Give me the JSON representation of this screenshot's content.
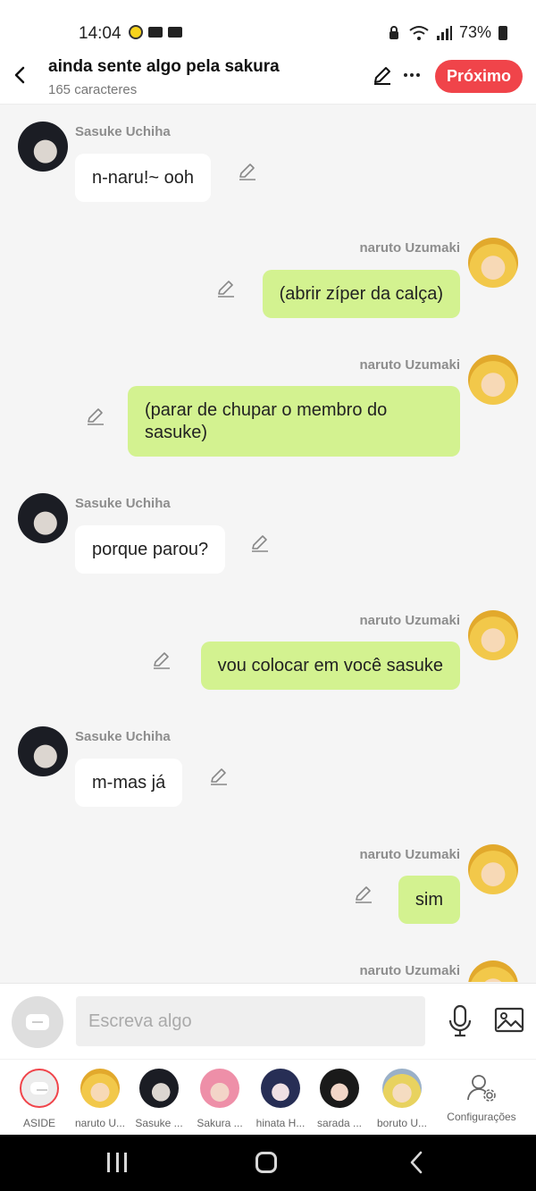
{
  "status": {
    "time": "14:04",
    "battery": "73%"
  },
  "header": {
    "title": "ainda sente algo pela sakura",
    "subtitle": "165 caracteres",
    "next_label": "Próximo"
  },
  "messages": [
    {
      "sender": "Sasuke Uchiha",
      "text": "n-naru!~ ooh",
      "side": "left"
    },
    {
      "sender": "naruto Uzumaki",
      "text": "(abrir zíper da calça)",
      "side": "right"
    },
    {
      "sender": "naruto Uzumaki",
      "text": "(parar de chupar o membro do sasuke)",
      "side": "right"
    },
    {
      "sender": "Sasuke Uchiha",
      "text": "porque parou?",
      "side": "left"
    },
    {
      "sender": "naruto Uzumaki",
      "text": "vou colocar em você sasuke",
      "side": "right"
    },
    {
      "sender": "Sasuke Uchiha",
      "text": "m-mas já",
      "side": "left"
    },
    {
      "sender": "naruto Uzumaki",
      "text": "sim",
      "side": "right"
    },
    {
      "sender": "naruto Uzumaki",
      "text": "",
      "side": "right"
    }
  ],
  "composer": {
    "placeholder": "Escreva algo"
  },
  "characters": [
    {
      "label": "ASIDE"
    },
    {
      "label": "naruto U..."
    },
    {
      "label": "Sasuke ..."
    },
    {
      "label": "Sakura ..."
    },
    {
      "label": "hinata H..."
    },
    {
      "label": "sarada ..."
    },
    {
      "label": "boruto U..."
    },
    {
      "label": "Configurações"
    }
  ],
  "colors": {
    "accent": "#f0444a",
    "right_bubble": "#d3f290",
    "left_bubble": "#ffffff",
    "background": "#f5f5f5"
  }
}
